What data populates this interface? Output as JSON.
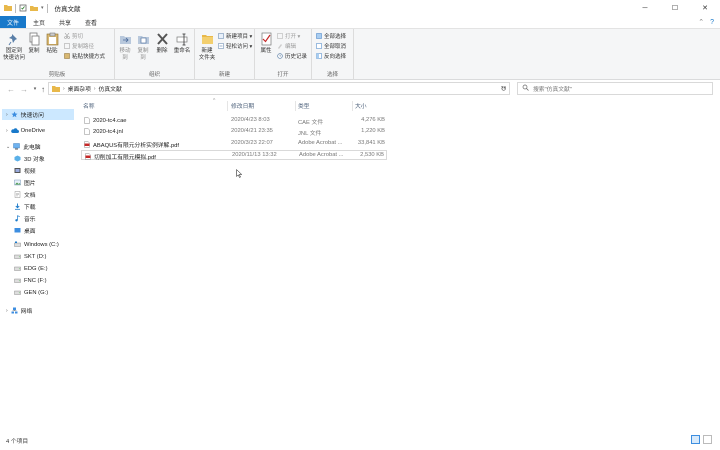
{
  "window": {
    "title": "仿真文献",
    "controls": {
      "minimize": "─",
      "maximize": "☐",
      "close": "✕"
    }
  },
  "ribbon_tabs": [
    "文件",
    "主页",
    "共享",
    "查看"
  ],
  "ribbon": {
    "clipboard": {
      "group_label": "剪贴板",
      "pin_label": "固定到\n快速访问",
      "copy_label": "复制",
      "paste_label": "粘贴",
      "cut_label": "剪切",
      "copy_path_label": "复制路径",
      "paste_shortcut_label": "粘贴快捷方式"
    },
    "organize": {
      "group_label": "组织",
      "move_to_label": "移动到",
      "copy_to_label": "复制到",
      "delete_label": "删除",
      "rename_label": "重命名"
    },
    "new": {
      "group_label": "新建",
      "new_folder_label": "新建\n文件夹",
      "new_item_label": "新建项目 ▾",
      "easy_access_label": "轻松访问 ▾"
    },
    "open": {
      "group_label": "打开",
      "properties_label": "属性",
      "open_label": "打开 ▾",
      "edit_label": "编辑",
      "history_label": "历史记录"
    },
    "select": {
      "group_label": "选择",
      "select_all_label": "全部选择",
      "select_none_label": "全部取消",
      "invert_label": "反向选择"
    }
  },
  "address": {
    "path": [
      "桌面杂项",
      "仿真文献"
    ],
    "search_placeholder": "搜索\"仿真文献\""
  },
  "nav": {
    "quick_access": "快速访问",
    "onedrive": "OneDrive",
    "this_pc": "此电脑",
    "pc_items": [
      "3D 对象",
      "视频",
      "图片",
      "文档",
      "下载",
      "音乐",
      "桌面"
    ],
    "drives": [
      "Windows (C:)",
      "SKT (D:)",
      "EDG (E:)",
      "FNC (F:)",
      "GEN (G:)"
    ],
    "network": "网络"
  },
  "filelist": {
    "columns": {
      "name": "名称",
      "date": "修改日期",
      "type": "类型",
      "size": "大小"
    },
    "sort_arrow": "^",
    "files": [
      {
        "name": "2020-tc4.cae",
        "date": "2020/4/23 8:03",
        "type": "CAE 文件",
        "size": "4,276 KB",
        "icon": "blank-file-icon"
      },
      {
        "name": "2020-tc4.jnl",
        "date": "2020/4/21 23:35",
        "type": "JNL 文件",
        "size": "1,220 KB",
        "icon": "blank-file-icon"
      },
      {
        "name": "ABAQUS有限元分析实例详解.pdf",
        "date": "2020/3/23 22:07",
        "type": "Adobe Acrobat ...",
        "size": "33,841 KB",
        "icon": "pdf-file-icon"
      },
      {
        "name": "切削加工有限元模拟.pdf",
        "date": "2020/11/13 13:32",
        "type": "Adobe Acrobat ...",
        "size": "2,530 KB",
        "icon": "pdf-file-icon"
      }
    ]
  },
  "status": {
    "item_count": "4 个项目"
  },
  "colors": {
    "accent": "#1979ca",
    "selection": "#cce8ff",
    "pdf_red": "#c62828"
  }
}
